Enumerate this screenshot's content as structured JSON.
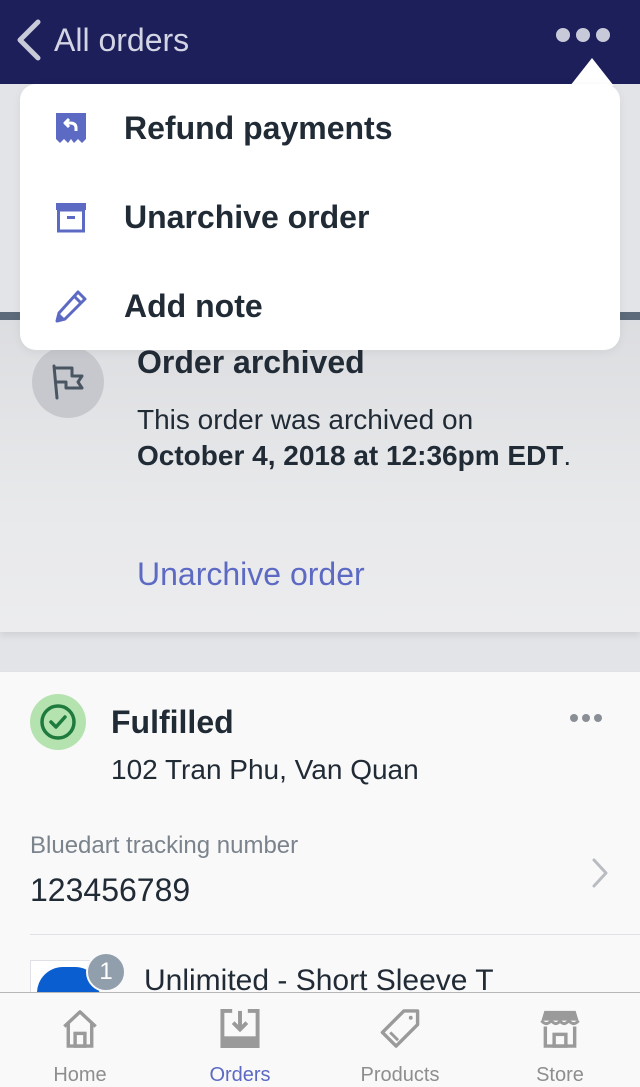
{
  "navbar": {
    "back_label": "All orders",
    "back_icon": "chevron-left-icon",
    "more_icon": "ellipsis-icon"
  },
  "dropdown": {
    "items": [
      {
        "label": "Refund payments",
        "icon": "receipt-refund-icon"
      },
      {
        "label": "Unarchive order",
        "icon": "archive-box-icon"
      },
      {
        "label": "Add note",
        "icon": "pencil-icon"
      }
    ]
  },
  "archived": {
    "title": "Order archived",
    "text_prefix": "This order was archived on ",
    "date": "October 4, 2018 at 12:36pm EDT",
    "text_suffix": ".",
    "link": "Unarchive order"
  },
  "fulfillment": {
    "status": "Fulfilled",
    "address": "102 Tran Phu, Van Quan",
    "tracking_label": "Bluedart tracking number",
    "tracking_number": "123456789",
    "line_item": {
      "title": "Unlimited - Short Sleeve T",
      "quantity": "1"
    }
  },
  "tabbar": {
    "tabs": [
      {
        "label": "Home",
        "icon": "home-icon",
        "active": false
      },
      {
        "label": "Orders",
        "icon": "orders-inbox-icon",
        "active": true
      },
      {
        "label": "Products",
        "icon": "tag-icon",
        "active": false
      },
      {
        "label": "Store",
        "icon": "store-icon",
        "active": false
      }
    ]
  },
  "colors": {
    "navbar_bg": "#1c1f5a",
    "accent": "#5c6ac4",
    "success_bg": "#b5e3b0",
    "success_stroke": "#1f7a3e",
    "text": "#212b36",
    "muted": "#7b838c"
  }
}
